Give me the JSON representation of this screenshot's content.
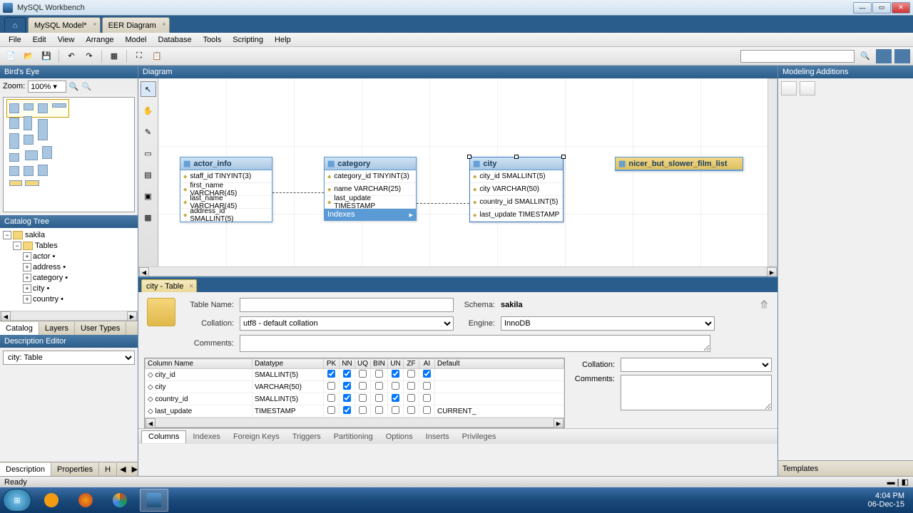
{
  "app": {
    "title": "MySQL Workbench"
  },
  "tabs": {
    "model": "MySQL Model*",
    "diagram": "EER Diagram"
  },
  "menu": [
    "File",
    "Edit",
    "View",
    "Arrange",
    "Model",
    "Database",
    "Tools",
    "Scripting",
    "Help"
  ],
  "birdseye": {
    "title": "Bird's Eye",
    "zoom_label": "Zoom:",
    "zoom": "100%"
  },
  "catalog": {
    "title": "Catalog Tree",
    "schema": "sakila",
    "tables_label": "Tables",
    "items": [
      "actor •",
      "address •",
      "category •",
      "city •",
      "country  •"
    ],
    "tabs": [
      "Catalog",
      "Layers",
      "User Types"
    ]
  },
  "desc": {
    "title": "Description Editor",
    "value": "city: Table",
    "tabs": [
      "Description",
      "Properties",
      "H"
    ]
  },
  "diagram": {
    "title": "Diagram",
    "tables": {
      "actor_info": {
        "name": "actor_info",
        "cols": [
          "staff_id TINYINT(3)",
          "first_name VARCHAR(45)",
          "last_name VARCHAR(45)",
          "address_id SMALLINT(5)"
        ]
      },
      "category": {
        "name": "category",
        "cols": [
          "category_id TINYINT(3)",
          "name VARCHAR(25)",
          "last_update TIMESTAMP"
        ],
        "idx": "Indexes"
      },
      "city": {
        "name": "city",
        "cols": [
          "city_id SMALLINT(5)",
          "city VARCHAR(50)",
          "country_id SMALLINT(5)",
          "last_update TIMESTAMP"
        ]
      },
      "nicer": {
        "name": "nicer_but_slower_film_list"
      }
    }
  },
  "editor": {
    "tab": "city - Table",
    "table_name_label": "Table Name:",
    "table_name": "",
    "schema_label": "Schema:",
    "schema": "sakila",
    "collation_label": "Collation:",
    "collation": "utf8 - default collation",
    "engine_label": "Engine:",
    "engine": "InnoDB",
    "comments_label": "Comments:",
    "grid": {
      "headers": [
        "Column Name",
        "Datatype",
        "PK",
        "NN",
        "UQ",
        "BIN",
        "UN",
        "ZF",
        "AI",
        "Default"
      ],
      "rows": [
        {
          "name": "city_id",
          "type": "SMALLINT(5)",
          "pk": true,
          "nn": true,
          "uq": false,
          "bin": false,
          "un": true,
          "zf": false,
          "ai": true,
          "def": ""
        },
        {
          "name": "city",
          "type": "VARCHAR(50)",
          "pk": false,
          "nn": true,
          "uq": false,
          "bin": false,
          "un": false,
          "zf": false,
          "ai": false,
          "def": ""
        },
        {
          "name": "country_id",
          "type": "SMALLINT(5)",
          "pk": false,
          "nn": true,
          "uq": false,
          "bin": false,
          "un": true,
          "zf": false,
          "ai": false,
          "def": ""
        },
        {
          "name": "last_update",
          "type": "TIMESTAMP",
          "pk": false,
          "nn": true,
          "uq": false,
          "bin": false,
          "un": false,
          "zf": false,
          "ai": false,
          "def": "CURRENT_"
        }
      ]
    },
    "side": {
      "collation_label": "Collation:",
      "comments_label": "Comments:"
    },
    "bottom_tabs": [
      "Columns",
      "Indexes",
      "Foreign Keys",
      "Triggers",
      "Partitioning",
      "Options",
      "Inserts",
      "Privileges"
    ]
  },
  "modeling": {
    "title": "Modeling Additions",
    "templates": "Templates"
  },
  "status": "Ready",
  "tray": {
    "time": "4:04 PM",
    "date": "06-Dec-15"
  }
}
